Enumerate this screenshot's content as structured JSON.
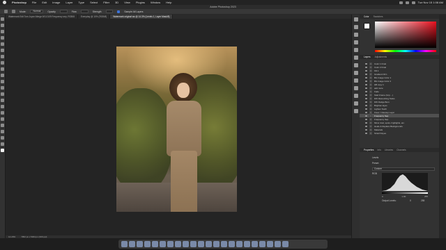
{
  "menubar": {
    "app_name": "Photoshop",
    "items": [
      "File",
      "Edit",
      "Image",
      "Layer",
      "Type",
      "Select",
      "Filter",
      "3D",
      "View",
      "Plugins",
      "Window",
      "Help"
    ],
    "clock": "Tue Nov 15  1:08 AM"
  },
  "window": {
    "title": "Adobe Photoshop 2023"
  },
  "options": {
    "mode_label": "Mode:",
    "mode_value": "Normal",
    "opacity_label": "Opacity",
    "flow_label": "Flow",
    "strength_label": "Strength",
    "sample_label": "Sample All Layers"
  },
  "tabs": [
    {
      "label": "Watermark Edit Tom Joyce-Merge-NS-0109 Frequency sep, RGB/8",
      "active": false
    },
    {
      "label": "Everyday @ 10% (RGB/8)",
      "active": false
    },
    {
      "label": "Watermark original ws @ 14.3% (Levels 1, Layer Mask/8)",
      "active": true
    }
  ],
  "status": {
    "zoom": "14.29%",
    "doc_size": "7952 px x 5304 px (300 ppi)"
  },
  "panels": {
    "top_tabs": [
      "Color",
      "Swatches"
    ],
    "adjust_tabs": [
      "Layers",
      "Adjustments"
    ],
    "layers": [
      {
        "name": "Color 1 Final",
        "selected": false
      },
      {
        "name": "Color 2 Final",
        "selected": false
      },
      {
        "name": "Fill 1",
        "selected": false
      },
      {
        "name": "Gradient Fill 1",
        "selected": false
      },
      {
        "name": "BG Image Color 1",
        "selected": false
      },
      {
        "name": "BG Image Color 2",
        "selected": false
      },
      {
        "name": "HB copy 1",
        "selected": false
      },
      {
        "name": "add more",
        "selected": false
      },
      {
        "name": "Fade",
        "selected": false
      },
      {
        "name": "Start Frame (Grp ...)",
        "selected": false
      },
      {
        "name": "DW Retouching Tasks",
        "selected": false
      },
      {
        "name": "DW Dodge Burn",
        "selected": false
      },
      {
        "name": "Brighten Eyes",
        "selected": false
      },
      {
        "name": "Lighten Teeth",
        "selected": false
      },
      {
        "name": "Fixes / Cleanup Layer",
        "selected": false
      },
      {
        "name": "Frequency Sep",
        "selected": true
      },
      {
        "name": "Frequency Sep",
        "selected": false
      },
      {
        "name": "Minor dust, spots, highlights, etc.",
        "selected": false
      },
      {
        "name": "Heals & Replace Backgrounds",
        "selected": false
      },
      {
        "name": "Materials",
        "selected": false
      },
      {
        "name": "Stretch Eyes",
        "selected": false
      }
    ],
    "props_tabs": [
      "Properties",
      "Info",
      "Libraries",
      "Channels"
    ],
    "props": {
      "title": "Levels",
      "preset_label": "Preset:",
      "preset_value": "Custom",
      "channel_value": "RGB",
      "input_low": "0",
      "input_mid": "1.00",
      "input_high": "255",
      "output_label": "Output Levels:",
      "output_low": "0",
      "output_high": "255"
    }
  }
}
